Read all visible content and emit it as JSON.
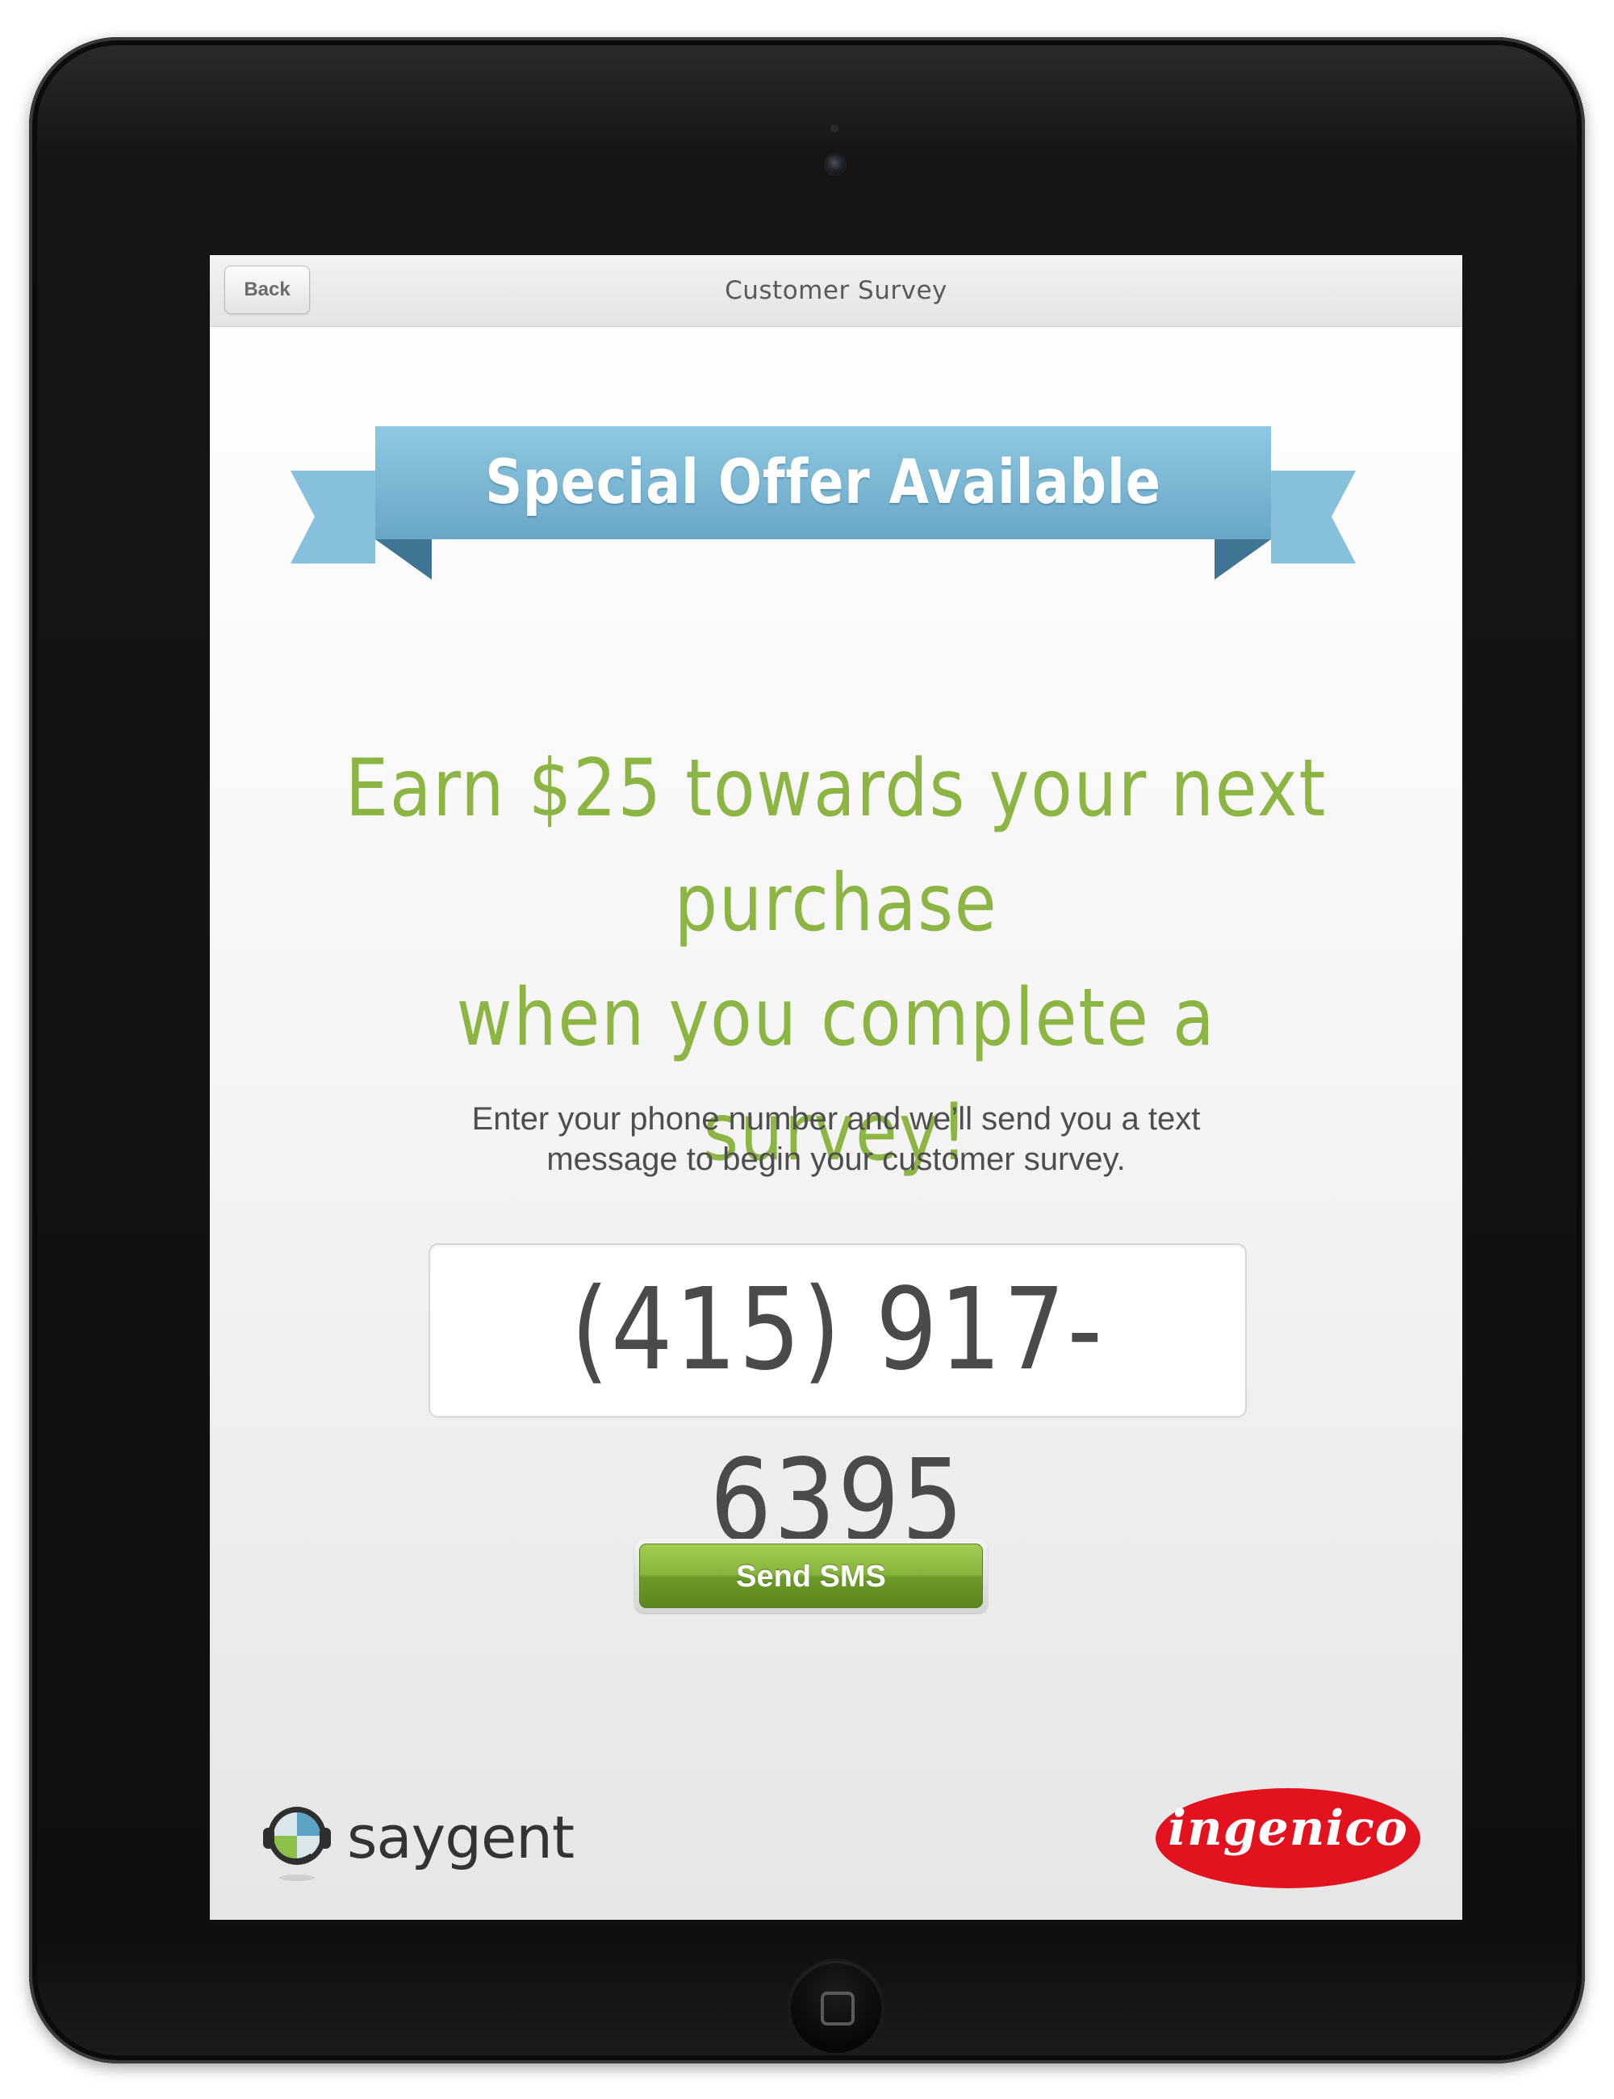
{
  "nav": {
    "back_label": "Back",
    "title": "Customer Survey"
  },
  "banner": {
    "title": "Special Offer Available",
    "color": "#86c0dc"
  },
  "offer": {
    "line1": "Earn $25 towards your next purchase",
    "line2": "when you complete a survey!",
    "color": "#8cb544"
  },
  "instructions": {
    "line1": "Enter your phone number and we’ll send you a text",
    "line2": "message to begin your customer survey."
  },
  "phone_input": {
    "value": "(415) 917-6395"
  },
  "send_button": {
    "label": "Send SMS",
    "color": "#86b33b"
  },
  "logos": {
    "saygent": "saygent",
    "ingenico": "ingenico",
    "ingenico_color": "#e3121f"
  }
}
